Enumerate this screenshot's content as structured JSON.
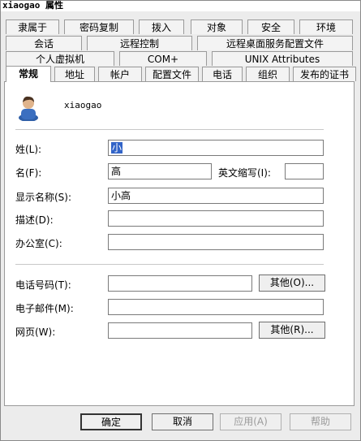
{
  "window": {
    "title": "xiaogao 属性"
  },
  "tabs": {
    "row1": [
      "隶属于",
      "密码复制",
      "拨入",
      "对象",
      "安全",
      "环境"
    ],
    "row2": [
      "会话",
      "远程控制",
      "远程桌面服务配置文件"
    ],
    "row3": [
      "个人虚拟机",
      "COM+",
      "UNIX Attributes"
    ],
    "row4": [
      "常规",
      "地址",
      "帐户",
      "配置文件",
      "电话",
      "组织",
      "发布的证书"
    ],
    "selected": "常规"
  },
  "general": {
    "username": "xiaogao",
    "last_name_label": "姓(L):",
    "last_name_value": "小",
    "first_name_label": "名(F):",
    "first_name_value": "高",
    "initials_label": "英文缩写(I):",
    "initials_value": "",
    "display_name_label": "显示名称(S):",
    "display_name_value": "小高",
    "description_label": "描述(D):",
    "description_value": "",
    "office_label": "办公室(C):",
    "office_value": "",
    "phone_label": "电话号码(T):",
    "phone_value": "",
    "phone_other_button": "其他(O)...",
    "email_label": "电子邮件(M):",
    "email_value": "",
    "webpage_label": "网页(W):",
    "webpage_value": "",
    "webpage_other_button": "其他(R)..."
  },
  "footer": {
    "ok": "确定",
    "cancel": "取消",
    "apply": "应用(A)",
    "help": "帮助"
  }
}
